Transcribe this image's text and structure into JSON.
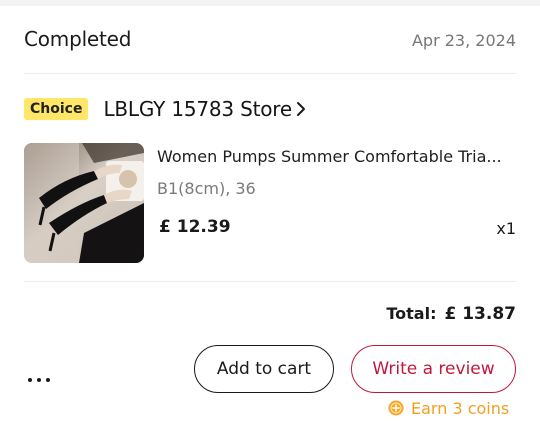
{
  "order": {
    "status": "Completed",
    "date": "Apr 23, 2024"
  },
  "store": {
    "badge": "Choice",
    "name": "LBLGY 15783 Store",
    "chevron_icon": "chevron-right-icon"
  },
  "product": {
    "title": "Women Pumps  Summer Comfortable Tria...",
    "variant": "B1(8cm), 36",
    "price": "£ 12.39",
    "quantity": "x1",
    "image_icon": "product-thumbnail"
  },
  "summary": {
    "total_label": "Total:",
    "total_value": "£ 13.87"
  },
  "actions": {
    "more_icon": "more-horizontal-icon",
    "add_to_cart": "Add to cart",
    "write_review": "Write a review",
    "earn_coins": "Earn 3 coins",
    "coin_icon": "coin-icon"
  },
  "colors": {
    "accent": "#c2173c",
    "choice_badge": "#ffe667",
    "coins": "#f0a020"
  }
}
